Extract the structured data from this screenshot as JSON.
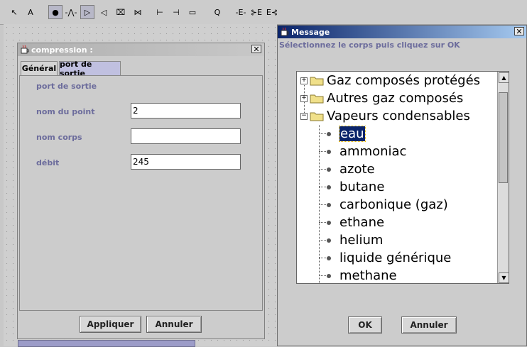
{
  "toolbar": {
    "tools": [
      {
        "name": "pointer-tool-button",
        "glyph": "↖",
        "pressed": false
      },
      {
        "name": "text-tool-button",
        "glyph": "A",
        "pressed": false
      },
      {
        "name": "node-tool-button",
        "glyph": "●",
        "pressed": true
      },
      {
        "name": "resistor-tool-button",
        "glyph": "-⋀-",
        "pressed": false
      },
      {
        "name": "compressor-tool-button",
        "glyph": "▷",
        "pressed": true
      },
      {
        "name": "turbine-tool-button",
        "glyph": "◁",
        "pressed": false
      },
      {
        "name": "combustion-tool-button",
        "glyph": "⌧",
        "pressed": false
      },
      {
        "name": "valve-tool-button",
        "glyph": "⋈",
        "pressed": false
      },
      {
        "name": "mixer-tool-button",
        "glyph": "⊢",
        "pressed": false
      },
      {
        "name": "splitter-tool-button",
        "glyph": "⊣",
        "pressed": false
      },
      {
        "name": "exchanger-tool-button",
        "glyph": "▭",
        "pressed": false
      },
      {
        "name": "q-tool-button",
        "glyph": "Q",
        "pressed": false
      },
      {
        "name": "e-tool-button",
        "glyph": "-E-",
        "pressed": false
      },
      {
        "name": "ein-tool-button",
        "glyph": "⊱E",
        "pressed": false
      },
      {
        "name": "eout-tool-button",
        "glyph": "E⊰",
        "pressed": false
      }
    ]
  },
  "compression_window": {
    "title": "compression :",
    "tabs": [
      "Général",
      "port de sortie"
    ],
    "section_title": "port de sortie",
    "fields": [
      {
        "label": "nom du point",
        "value": "2"
      },
      {
        "label": "nom corps",
        "value": ""
      },
      {
        "label": "débit",
        "value": "245"
      }
    ],
    "apply_label": "Appliquer",
    "cancel_label": "Annuler"
  },
  "message_window": {
    "title": "Message",
    "instruction": "Sélectionnez le corps puis cliquez sur OK",
    "tree": {
      "folders": [
        "Gaz composés protégés",
        "Autres gaz composés",
        "Vapeurs condensables"
      ],
      "leaves": [
        "eau",
        "ammoniac",
        "azote",
        "butane",
        "carbonique (gaz)",
        "ethane",
        "helium",
        "liquide générique",
        "methane"
      ],
      "selected": "eau"
    },
    "ok_label": "OK",
    "cancel_label": "Annuler"
  },
  "colors": {
    "selection": "#0a246a",
    "title_gradient_start": "#0a246a",
    "label": "#6c6c9c"
  }
}
